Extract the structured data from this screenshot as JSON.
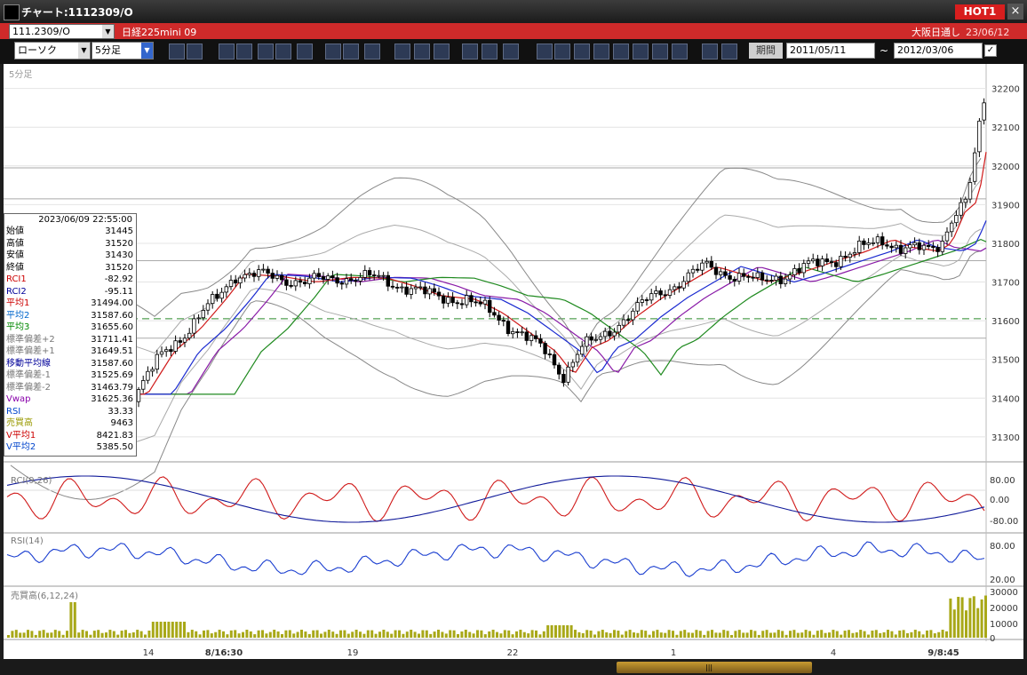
{
  "window": {
    "title": "チャート:1112309/O",
    "hot_label": "HOT1",
    "close_label": "×"
  },
  "instrument_bar": {
    "symbol": "111.2309/O",
    "name": "日経225mini 09",
    "exchange": "大阪日通し",
    "date": "23/06/12"
  },
  "toolbar": {
    "chart_type": "ローソク",
    "timeframe": "5分足",
    "buttons": [
      "zoom",
      "bar-width",
      "download",
      "find",
      "tile",
      "flip",
      "blank",
      "pen",
      "cursor",
      "redo",
      "compare1",
      "compare2",
      "ALL",
      "settings",
      "tool",
      "color",
      "SMA",
      "MA",
      "BB",
      "WRE",
      "HL",
      "ATR",
      "RC",
      "PVT",
      "Log",
      "export"
    ],
    "period_label": "期間",
    "date_from": "2011/05/11",
    "date_to": "2012/03/06",
    "range_sep": "~"
  },
  "chart": {
    "timeframe_label": "5分足",
    "price_ticks": [
      "32200",
      "32100",
      "32000",
      "31900",
      "31800",
      "31700",
      "31600",
      "31500",
      "31400",
      "31300"
    ],
    "rci_label": "RCI(9,26)",
    "rci_ticks": [
      "80.00",
      "0.00",
      "-80.00"
    ],
    "rsi_label": "RSI(14)",
    "rsi_ticks": [
      "80.00",
      "20.00"
    ],
    "vol_label": "売買高(6,12,24)",
    "vol_ticks": [
      "30000",
      "20000",
      "10000",
      "0"
    ],
    "x_ticks": [
      "14",
      "8/16:30",
      "19",
      "22",
      "1",
      "4",
      "9/8:45"
    ]
  },
  "infobox": {
    "datetime": "2023/06/09  22:55:00",
    "rows": [
      {
        "label": "始値",
        "value": "31445",
        "color": "#000000"
      },
      {
        "label": "高値",
        "value": "31520",
        "color": "#000000"
      },
      {
        "label": "安値",
        "value": "31430",
        "color": "#000000"
      },
      {
        "label": "終値",
        "value": "31520",
        "color": "#000000"
      },
      {
        "label": "RCI1",
        "value": "-82.92",
        "color": "#cc0000"
      },
      {
        "label": "RCI2",
        "value": "-95.11",
        "color": "#000099"
      },
      {
        "label": "平均1",
        "value": "31494.00",
        "color": "#cc0000"
      },
      {
        "label": "平均2",
        "value": "31587.60",
        "color": "#0066cc"
      },
      {
        "label": "平均3",
        "value": "31655.60",
        "color": "#008800"
      },
      {
        "label": "標準偏差+2",
        "value": "31711.41",
        "color": "#777777"
      },
      {
        "label": "標準偏差+1",
        "value": "31649.51",
        "color": "#777777"
      },
      {
        "label": "移動平均線",
        "value": "31587.60",
        "color": "#000099"
      },
      {
        "label": "標準偏差-1",
        "value": "31525.69",
        "color": "#777777"
      },
      {
        "label": "標準偏差-2",
        "value": "31463.79",
        "color": "#777777"
      },
      {
        "label": "Vwap",
        "value": "31625.36",
        "color": "#8800aa"
      },
      {
        "label": "RSI",
        "value": "33.33",
        "color": "#0044cc"
      },
      {
        "label": "売買高",
        "value": "9463",
        "color": "#999900"
      },
      {
        "label": "V平均1",
        "value": "8421.83",
        "color": "#cc0000"
      },
      {
        "label": "V平均2",
        "value": "5385.50",
        "color": "#0044cc"
      }
    ]
  },
  "scrollbar": {
    "grip": "|||"
  }
}
